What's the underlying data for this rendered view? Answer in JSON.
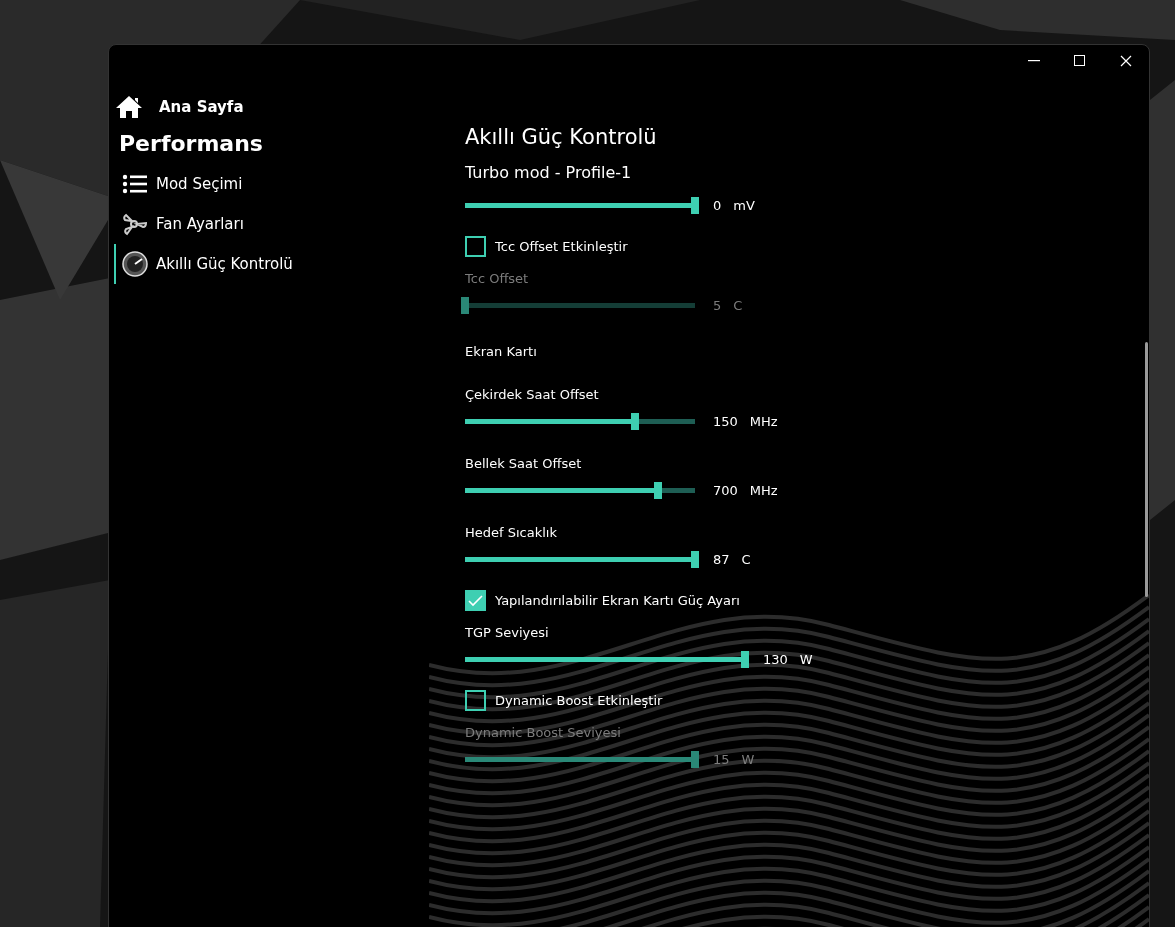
{
  "sidebar": {
    "home": {
      "label": "Ana Sayfa"
    },
    "section": "Performans",
    "items": [
      {
        "label": "Mod Seçimi",
        "selected": false
      },
      {
        "label": "Fan Ayarları",
        "selected": false
      },
      {
        "label": "Akıllı Güç Kontrolü",
        "selected": true
      }
    ]
  },
  "content": {
    "title": "Akıllı Güç Kontrolü",
    "subtitle": "Turbo mod - Profile-1",
    "rows": [
      {
        "kind": "slider",
        "level": 1,
        "value": "0",
        "unit": "mV",
        "disabled": false,
        "wide": false
      },
      {
        "kind": "checkbox",
        "label": "Tcc Offset Etkinleştir",
        "checked": false
      },
      {
        "kind": "slider",
        "label": "Tcc Offset",
        "level": 0,
        "value": "5",
        "unit": "C",
        "disabled": true,
        "wide": false
      },
      {
        "kind": "heading",
        "label": "Ekran Kartı"
      },
      {
        "kind": "slider",
        "label": "Çekirdek Saat Offset",
        "level": 0.74,
        "value": "150",
        "unit": "MHz",
        "disabled": false,
        "wide": false
      },
      {
        "kind": "slider",
        "label": "Bellek Saat Offset",
        "level": 0.84,
        "value": "700",
        "unit": "MHz",
        "disabled": false,
        "wide": false
      },
      {
        "kind": "slider",
        "label": "Hedef Sıcaklık",
        "level": 1,
        "value": "87",
        "unit": "C",
        "disabled": false,
        "wide": false
      },
      {
        "kind": "checkbox",
        "label": "Yapılandırılabilir Ekran Kartı Güç Ayarı",
        "checked": true
      },
      {
        "kind": "slider",
        "label": "TGP Seviyesi",
        "level": 1,
        "value": "130",
        "unit": "W",
        "disabled": false,
        "wide": true
      },
      {
        "kind": "checkbox",
        "label": "Dynamic Boost Etkinleştir",
        "checked": false
      },
      {
        "kind": "slider",
        "label": "Dynamic Boost Seviyesi",
        "level": 1,
        "value": "15",
        "unit": "W",
        "disabled": true,
        "wide": false
      }
    ]
  }
}
